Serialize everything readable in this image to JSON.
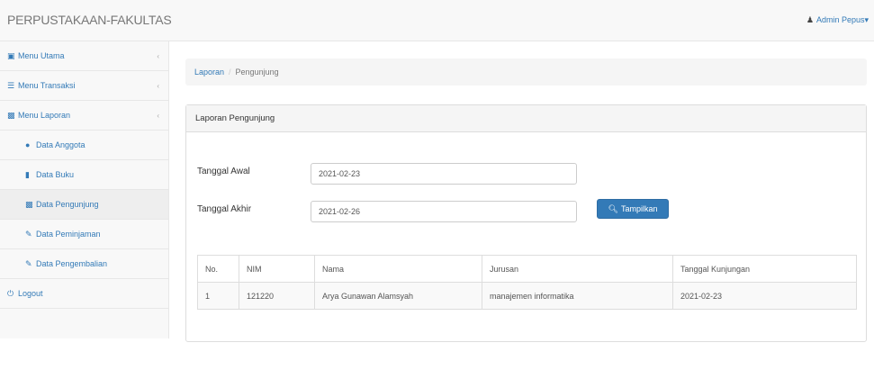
{
  "header": {
    "brand": "PERPUSTAKAAN-FAKULTAS",
    "user_label": "Admin Pepus",
    "user_caret": "▾"
  },
  "sidebar": {
    "items": [
      {
        "label": "Menu Utama",
        "icon": "monitor-icon",
        "arrow": "‹"
      },
      {
        "label": "Menu Transaksi",
        "icon": "list-icon",
        "arrow": "‹"
      },
      {
        "label": "Menu Laporan",
        "icon": "file-icon",
        "arrow": "‹"
      }
    ],
    "subitems": [
      {
        "label": "Data Anggota",
        "icon": "users-icon"
      },
      {
        "label": "Data Buku",
        "icon": "book-icon"
      },
      {
        "label": "Data Pengunjung",
        "icon": "file-icon"
      },
      {
        "label": "Data Peminjaman",
        "icon": "edit-icon"
      },
      {
        "label": "Data Pengembalian",
        "icon": "edit-icon"
      }
    ],
    "logout": {
      "label": "Logout",
      "icon": "power-icon"
    }
  },
  "breadcrumb": {
    "link": "Laporan",
    "separator": "/",
    "active": "Pengunjung"
  },
  "panel": {
    "title": "Laporan Pengunjung"
  },
  "form": {
    "start_label": "Tanggal Awal",
    "start_value": "2021-02-23",
    "end_label": "Tanggal Akhir",
    "end_value": "2021-02-26",
    "button_label": "Tampilkan"
  },
  "table": {
    "headers": [
      "No.",
      "NIM",
      "Nama",
      "Jurusan",
      "Tanggal Kunjungan"
    ],
    "rows": [
      [
        "1",
        "121220",
        "Arya Gunawan Alamsyah",
        "manajemen informatika",
        "2021-02-23"
      ]
    ]
  }
}
